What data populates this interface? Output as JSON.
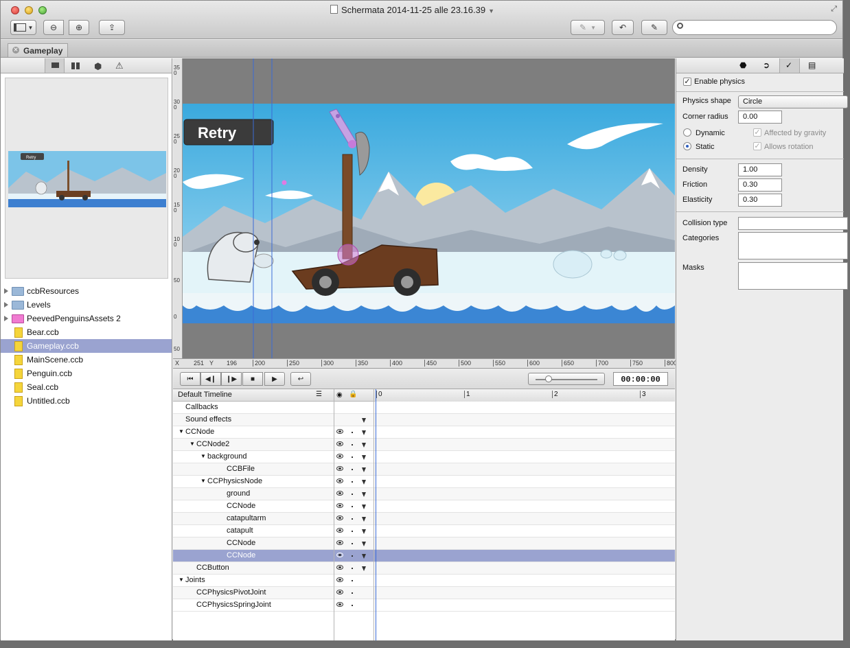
{
  "window": {
    "title": "Schermata 2014-11-25 alle 23.16.39"
  },
  "tab": {
    "label": "Gameplay"
  },
  "left_panel": {
    "preview_label": "Retry",
    "tree": [
      {
        "label": "ccbResources",
        "kind": "folder",
        "expandable": true
      },
      {
        "label": "Levels",
        "kind": "folder",
        "expandable": true
      },
      {
        "label": "PeevedPenguinsAssets 2",
        "kind": "asset-folder",
        "expandable": true
      },
      {
        "label": "Bear.ccb",
        "kind": "file"
      },
      {
        "label": "Gameplay.ccb",
        "kind": "file",
        "selected": true
      },
      {
        "label": "MainScene.ccb",
        "kind": "file"
      },
      {
        "label": "Penguin.ccb",
        "kind": "file"
      },
      {
        "label": "Seal.ccb",
        "kind": "file"
      },
      {
        "label": "Untitled.ccb",
        "kind": "file"
      }
    ]
  },
  "canvas": {
    "retry_label": "Retry",
    "hruler": {
      "x_label": "X",
      "x_value": "251",
      "y_label": "Y",
      "y_value": "196",
      "ticks": [
        "200",
        "250",
        "300",
        "350",
        "400",
        "450",
        "500",
        "550",
        "600",
        "650",
        "700",
        "750",
        "800"
      ]
    },
    "vruler_ticks": [
      "350",
      "300",
      "250",
      "200",
      "150",
      "100",
      "50",
      "0",
      "50"
    ]
  },
  "timeline": {
    "timecode": "00:00:00",
    "header": "Default Timeline",
    "ruler_ticks": [
      "0",
      "1",
      "2",
      "3"
    ],
    "rows": [
      {
        "label": "Callbacks",
        "indent": 0,
        "hdr": true
      },
      {
        "label": "Sound effects",
        "indent": 0,
        "hdr": true
      },
      {
        "label": "CCNode",
        "indent": 0,
        "expanded": true
      },
      {
        "label": "CCNode2",
        "indent": 1,
        "expanded": true
      },
      {
        "label": "background",
        "indent": 2,
        "expanded": true
      },
      {
        "label": "CCBFile",
        "indent": 3
      },
      {
        "label": "CCPhysicsNode",
        "indent": 2,
        "expanded": true
      },
      {
        "label": "ground",
        "indent": 3
      },
      {
        "label": "CCNode",
        "indent": 3
      },
      {
        "label": "catapultarm",
        "indent": 3
      },
      {
        "label": "catapult",
        "indent": 3
      },
      {
        "label": "CCNode",
        "indent": 3
      },
      {
        "label": "CCNode",
        "indent": 3,
        "selected": true
      },
      {
        "label": "CCButton",
        "indent": 1
      },
      {
        "label": "Joints",
        "indent": 0,
        "expanded": true
      },
      {
        "label": "CCPhysicsPivotJoint",
        "indent": 1
      },
      {
        "label": "CCPhysicsSpringJoint",
        "indent": 1
      }
    ]
  },
  "physics": {
    "enable_label": "Enable physics",
    "shape_label": "Physics shape",
    "shape_value": "Circle",
    "corner_label": "Corner radius",
    "corner_value": "0.00",
    "dynamic_label": "Dynamic",
    "static_label": "Static",
    "gravity_label": "Affected by gravity",
    "rotation_label": "Allows rotation",
    "density_label": "Density",
    "density_value": "1.00",
    "friction_label": "Friction",
    "friction_value": "0.30",
    "elasticity_label": "Elasticity",
    "elasticity_value": "0.30",
    "collision_label": "Collision type",
    "categories_label": "Categories",
    "masks_label": "Masks"
  },
  "colors": {
    "selection": "#9aa3d0",
    "sky": "#49b3e4",
    "snow": "#dff3fb",
    "guide": "#3b6bd6"
  }
}
